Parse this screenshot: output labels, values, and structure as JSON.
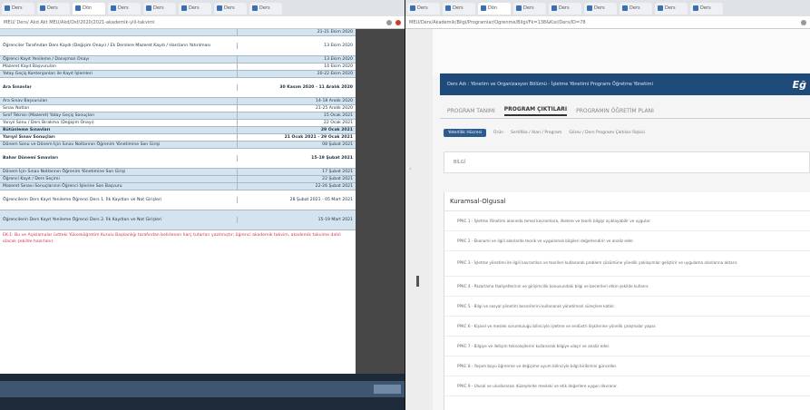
{
  "left": {
    "tabs": [
      "Ders",
      "Ders",
      "Dön",
      "Ders",
      "Ders",
      "Ders",
      "Ders",
      "Ders"
    ],
    "url": "MEU/ Ders/ Akd Akt MEU/Akd/Dsf/2020/2021-akademik-yili-takvimi",
    "rows": [
      {
        "label": "",
        "value": "21-21 Ekim 2020",
        "style": "blue"
      },
      {
        "label": "Öğrenciler Tarafından Ders Kaydı (Değişim Onayı) / Ek Derslere Mazeret Kaydı / Harcların Yatırılması",
        "value": "13 Ekim 2020",
        "style": "tall"
      },
      {
        "label": "Öğrenci Kayıt Yenileme / Danışman Onayı",
        "value": "13 Ekim 2020",
        "style": "blue"
      },
      {
        "label": "Mazeret Kayıt Başvuruları",
        "value": "14 Ekim 2020",
        "style": ""
      },
      {
        "label": "Yatay Geçiş Kontenjanları ile Kayıt İşlemleri",
        "value": "20-22 Ekim 2020",
        "style": "blue"
      },
      {
        "label": "Ara Sınavlar",
        "value": "30 Kasım 2020 - 11 Aralık 2020",
        "style": "tall bold"
      },
      {
        "label": "Ara Sınav Başvuruları",
        "value": "14-18 Aralık 2020",
        "style": "blue"
      },
      {
        "label": "Sınav Notları",
        "value": "21-25 Aralık 2020",
        "style": ""
      },
      {
        "label": "Sınıf Tekrarı (Mazeret) Yatay Geçiş Sonuçları",
        "value": "15 Ocak 2021",
        "style": "blue"
      },
      {
        "label": "Yarıyıl Sonu / Ders Bırakma (Değişim Onayı)",
        "value": "22 Ocak 2021",
        "style": ""
      },
      {
        "label": "Bütünleme Sınavları",
        "value": "29 Ocak 2021",
        "style": "blue bold"
      },
      {
        "label": "Yarıyıl Sınav Sonuçları",
        "value": "21 Ocak 2021 - 29 Ocak 2021",
        "style": "bold"
      },
      {
        "label": "Dönem Sonu ve Dönem İçin Sınav Notlarının Öğrenim Yönetimine Son Girişi",
        "value": "08 Şubat 2021",
        "style": "blue"
      },
      {
        "label": "Bahar Dönemi Sınavları",
        "value": "15-19 Şubat 2021",
        "style": "tall bold"
      },
      {
        "label": "Dönem İçin Sınav Notlarının Öğrenim Yönetimine Son Girişi",
        "value": "17 Şubat 2021",
        "style": "blue"
      },
      {
        "label": "Öğrenci Kayıt / Ders Seçimi",
        "value": "22 Şubat 2021",
        "style": "blue"
      },
      {
        "label": "Mazeret Sınavı Sonuçlarının Öğrenci İşlerine Son Başvuru",
        "value": "22-26 Şubat 2021",
        "style": "blue"
      },
      {
        "label": "Öğrencilerin Ders Kayıt Yenileme Öğrenci Ders 1. İlk Kayıtları ve Not Girişleri",
        "value": "28 Şubat 2021 - 05 Mart 2021",
        "style": "tall"
      },
      {
        "label": "Öğrencilerin Ders Kayıt Yenileme Öğrenci Ders 2. İlk Kayıtları ve Not Girişleri",
        "value": "15-19 Mart 2021",
        "style": "tall blue"
      }
    ],
    "note": "EK-1: Bu ve Açıklamalar üstteki Yükseköğretim Kurulu Başkanlığı tarafından belirlenen harç tutarları yazılmıştır; öğrenci akademik takvim, akademik takvime dahil olacak şekilde hazırlanır."
  },
  "right": {
    "tabs": [
      "Ders",
      "Ders",
      "Dön",
      "Ders",
      "Ders",
      "Ders",
      "Ders",
      "Ders",
      "Ders"
    ],
    "url": "MEU/Ders/Akademik/Bilgi/Programlar/Ogrenme/Bilgi/Fk=138&Kisi/Ders/ID=78",
    "banner": "Ders Adı : Yönetim ve Organizasyon Bölümü - İşletme Yönetimi Programı Öğretme Yönetimi",
    "logo": "Eğ",
    "subtabs": [
      "PROGRAM TANIMI",
      "PROGRAM ÇIKTILARI",
      "PROGRAMIN ÖĞRETİM PLANI"
    ],
    "pills": [
      "Yeterlilik Hücresi",
      "Ürün",
      "Sertifika / Alan / Program",
      "Görev / Ders Programı Çıktıları İlişkisi"
    ],
    "bilgi": "BİLGİ",
    "section_title": "Kuramsal-Olgusal",
    "outcomes": [
      "PPKC 1 - İşletme Yönetimi alanında temel kavramlara, ilkelere ve teorik bilgiyi açıklayabilir ve uygular.",
      "PPKC 2 - Ekonomi ve ilgili alanlarda teorik ve uygulamalı bilgileri değerlendirir ve analiz eder.",
      "PPKC 3 - İşletme yönetimi ile ilgili kavramları ve teorileri kullanarak problem çözümüne yönelik yaklaşımlar geliştirir ve uygulama alanlarına aktarır.",
      "PPKC 4 - Pazarlama faaliyetlerinin ve girişimcilik konusundaki bilgi ve becerileri etkin şekilde kullanır.",
      "PPKC 5 - Bilgi ve sosyal yönetim becerilerini kullanarak yönetimsel süreçlere katılır.",
      "PPKC 6 - Kişisel ve meslek sorumluluğu bilinciyle işletme ve endüstri ilişkilerine yönelik çalışmalar yapar.",
      "PPKC 7 - Bilgiye ve iletişim teknolojilerini kullanarak bilgiye ulaşır ve analiz eder.",
      "PPKC 8 - Yaşam boyu öğrenme ve değişime uyum bilinciyle bilgi birikimini günceller.",
      "PPKC 9 - Ulusal ve uluslararası düzeylerde mesleki ve etik değerlere uygun davranır."
    ]
  }
}
